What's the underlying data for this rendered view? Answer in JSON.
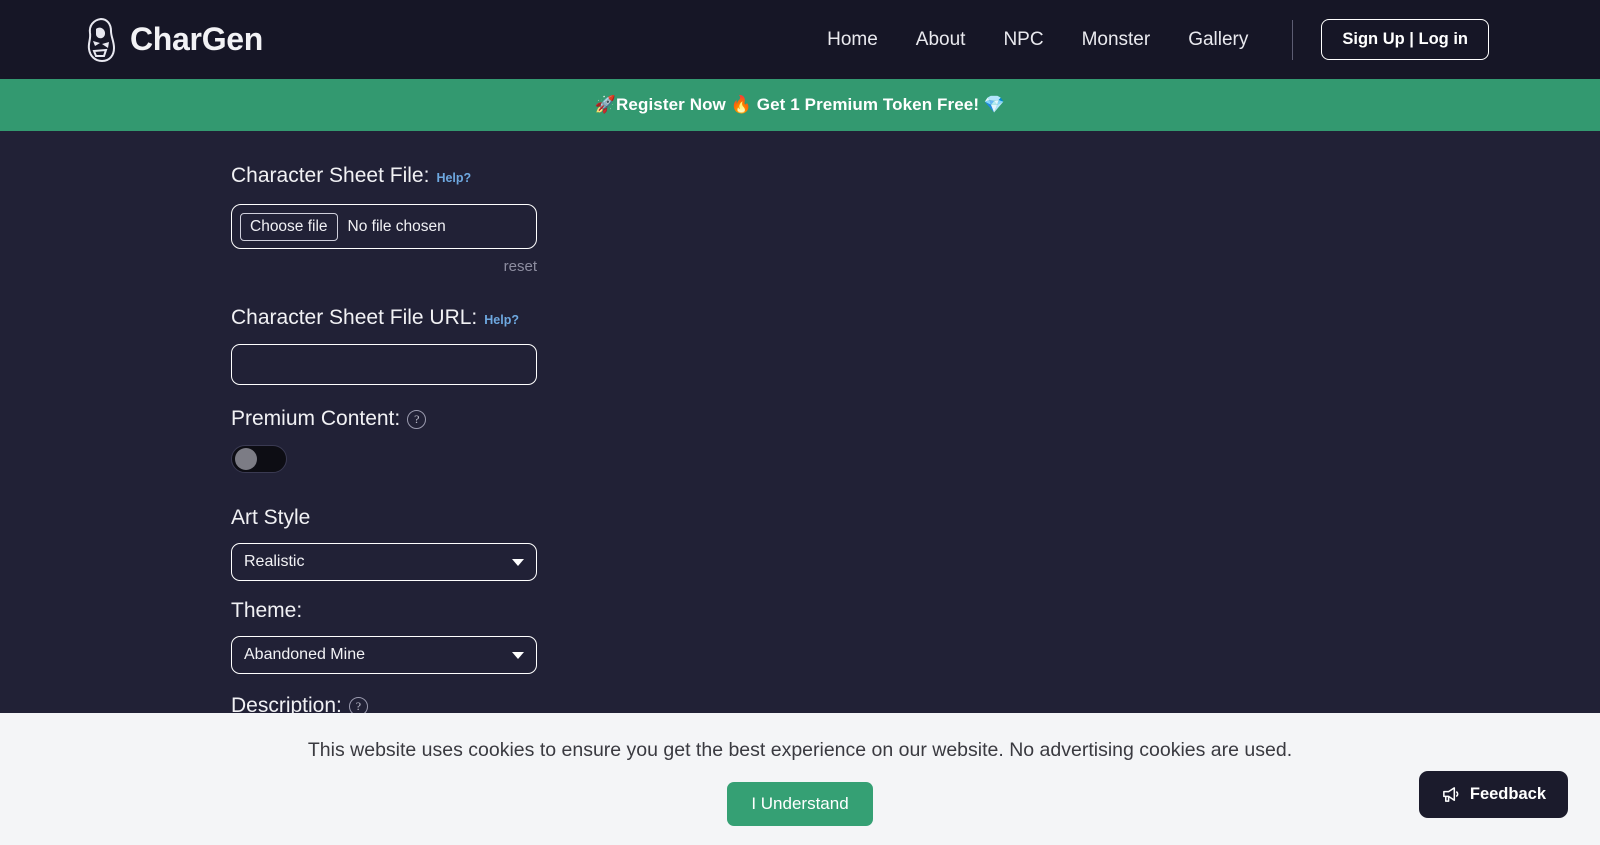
{
  "header": {
    "brand": "CharGen",
    "logo_icon": "dragon-head-logo-icon",
    "nav": [
      {
        "label": "Home"
      },
      {
        "label": "About"
      },
      {
        "label": "NPC"
      },
      {
        "label": "Monster"
      },
      {
        "label": "Gallery"
      }
    ],
    "auth_button": "Sign Up | Log in"
  },
  "promo": {
    "text": "🚀Register Now 🔥 Get 1 Premium Token Free! 💎"
  },
  "form": {
    "file_field": {
      "label": "Character Sheet File:",
      "help": "Help?",
      "choose_button": "Choose file",
      "status": "No file chosen",
      "reset": "reset"
    },
    "url_field": {
      "label": "Character Sheet File URL:",
      "help": "Help?",
      "value": "",
      "placeholder": ""
    },
    "premium": {
      "label": "Premium Content:",
      "help_icon": "question-mark-circle-icon",
      "enabled": false
    },
    "art_style": {
      "label": "Art Style",
      "selected": "Realistic"
    },
    "theme": {
      "label": "Theme:",
      "selected": "Abandoned Mine"
    },
    "description": {
      "label": "Description:",
      "help_icon": "question-mark-circle-icon",
      "value": ""
    }
  },
  "cookie": {
    "message": "This website uses cookies to ensure you get the best experience on our website. No advertising cookies are used.",
    "accept_label": "I Understand"
  },
  "feedback": {
    "label": "Feedback",
    "icon": "megaphone-icon"
  },
  "colors": {
    "page_background": "#212136",
    "header_background": "#161626",
    "accent_green": "#339970",
    "cookie_background": "#f4f5f7",
    "help_link": "#6ea8e0"
  }
}
